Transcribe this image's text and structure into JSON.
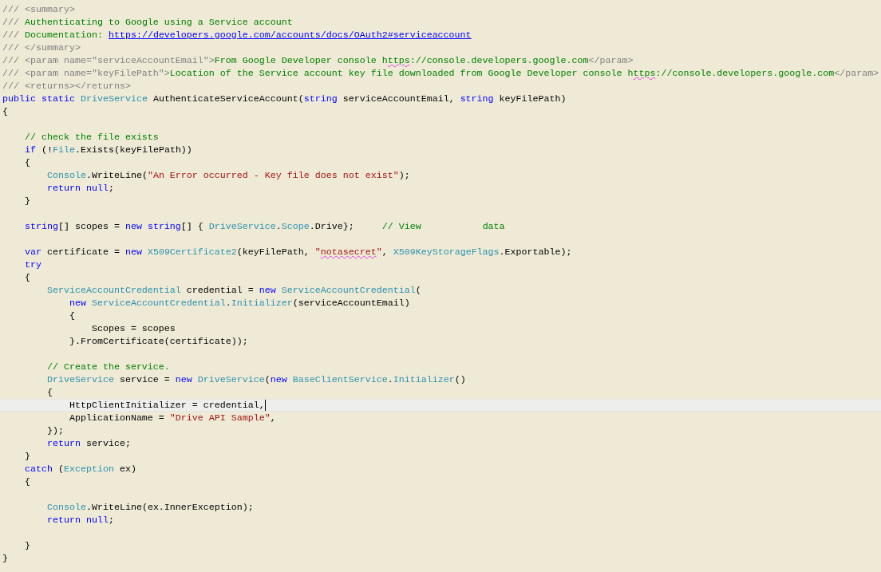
{
  "editor": {
    "lines": [
      {
        "current": false,
        "tokens": [
          {
            "text": "/// <summary>",
            "kind": "doc"
          }
        ]
      },
      {
        "current": false,
        "tokens": [
          {
            "text": "/// ",
            "kind": "doc"
          },
          {
            "text": "Authenticating to Google using a Service account",
            "kind": "comment"
          }
        ]
      },
      {
        "current": false,
        "tokens": [
          {
            "text": "/// ",
            "kind": "doc"
          },
          {
            "text": "Documentation: ",
            "kind": "comment"
          },
          {
            "text": "https://developers.google.com/accounts/docs/OAuth2#serviceaccount",
            "kind": "link"
          }
        ]
      },
      {
        "current": false,
        "tokens": [
          {
            "text": "/// </summary>",
            "kind": "doc"
          }
        ]
      },
      {
        "current": false,
        "tokens": [
          {
            "text": "/// <param name=\"serviceAccountEmail\">",
            "kind": "doc"
          },
          {
            "text": "From Google Developer console h",
            "kind": "comment"
          },
          {
            "text": "ttps",
            "kind": "typo"
          },
          {
            "text": "://console.developers.google.com",
            "kind": "comment"
          },
          {
            "text": "</param>",
            "kind": "doc"
          }
        ]
      },
      {
        "current": false,
        "tokens": [
          {
            "text": "/// <param name=\"keyFilePath\">",
            "kind": "doc"
          },
          {
            "text": "Location of the Service account key file downloaded from Google Developer console h",
            "kind": "comment"
          },
          {
            "text": "ttps",
            "kind": "typo"
          },
          {
            "text": "://console.developers.google.com",
            "kind": "comment"
          },
          {
            "text": "</param>",
            "kind": "doc"
          }
        ]
      },
      {
        "current": false,
        "tokens": [
          {
            "text": "/// <returns></returns>",
            "kind": "doc"
          }
        ]
      },
      {
        "current": false,
        "tokens": [
          {
            "text": "public static ",
            "kind": "keyword"
          },
          {
            "text": "DriveService",
            "kind": "type"
          },
          {
            "text": " AuthenticateServiceAccount(",
            "kind": "plain"
          },
          {
            "text": "string",
            "kind": "keyword"
          },
          {
            "text": " serviceAccountEmail, ",
            "kind": "plain"
          },
          {
            "text": "string",
            "kind": "keyword"
          },
          {
            "text": " keyFilePath)",
            "kind": "plain"
          }
        ]
      },
      {
        "current": false,
        "tokens": [
          {
            "text": "{",
            "kind": "plain"
          }
        ]
      },
      {
        "current": false
      },
      {
        "current": false,
        "tokens": [
          {
            "text": "    // check the file exists",
            "kind": "comment"
          }
        ]
      },
      {
        "current": false,
        "tokens": [
          {
            "text": "    if",
            "kind": "keyword"
          },
          {
            "text": " (!",
            "kind": "plain"
          },
          {
            "text": "File",
            "kind": "type"
          },
          {
            "text": ".Exists(keyFilePath))",
            "kind": "plain"
          }
        ]
      },
      {
        "current": false,
        "tokens": [
          {
            "text": "    {",
            "kind": "plain"
          }
        ]
      },
      {
        "current": false,
        "tokens": [
          {
            "text": "        Console",
            "kind": "type"
          },
          {
            "text": ".WriteLine(",
            "kind": "plain"
          },
          {
            "text": "\"An Error occurred - Key file does not exist\"",
            "kind": "string"
          },
          {
            "text": ");",
            "kind": "plain"
          }
        ]
      },
      {
        "current": false,
        "tokens": [
          {
            "text": "        return null",
            "kind": "keyword"
          },
          {
            "text": ";",
            "kind": "plain"
          }
        ]
      },
      {
        "current": false,
        "tokens": [
          {
            "text": "    }",
            "kind": "plain"
          }
        ]
      },
      {
        "current": false
      },
      {
        "current": false,
        "tokens": [
          {
            "text": "    string",
            "kind": "keyword"
          },
          {
            "text": "[] scopes = ",
            "kind": "plain"
          },
          {
            "text": "new string",
            "kind": "keyword"
          },
          {
            "text": "[] { ",
            "kind": "plain"
          },
          {
            "text": "DriveService",
            "kind": "type"
          },
          {
            "text": ".",
            "kind": "plain"
          },
          {
            "text": "Scope",
            "kind": "type"
          },
          {
            "text": ".Drive};     ",
            "kind": "plain"
          },
          {
            "text": "// View           data",
            "kind": "comment"
          }
        ]
      },
      {
        "current": false
      },
      {
        "current": false,
        "tokens": [
          {
            "text": "    var",
            "kind": "keyword"
          },
          {
            "text": " certificate = ",
            "kind": "plain"
          },
          {
            "text": "new ",
            "kind": "keyword"
          },
          {
            "text": "X509Certificate2",
            "kind": "type"
          },
          {
            "text": "(keyFilePath, ",
            "kind": "plain"
          },
          {
            "text": "\"",
            "kind": "string"
          },
          {
            "text": "notasecret",
            "kind": "stringtypo"
          },
          {
            "text": "\"",
            "kind": "string"
          },
          {
            "text": ", ",
            "kind": "plain"
          },
          {
            "text": "X509KeyStorageFlags",
            "kind": "type"
          },
          {
            "text": ".Exportable);",
            "kind": "plain"
          }
        ]
      },
      {
        "current": false,
        "tokens": [
          {
            "text": "    try",
            "kind": "keyword"
          }
        ]
      },
      {
        "current": false,
        "tokens": [
          {
            "text": "    {",
            "kind": "plain"
          }
        ]
      },
      {
        "current": false,
        "tokens": [
          {
            "text": "        ServiceAccountCredential",
            "kind": "type"
          },
          {
            "text": " credential = ",
            "kind": "plain"
          },
          {
            "text": "new ",
            "kind": "keyword"
          },
          {
            "text": "ServiceAccountCredential",
            "kind": "type"
          },
          {
            "text": "(",
            "kind": "plain"
          }
        ]
      },
      {
        "current": false,
        "tokens": [
          {
            "text": "            new ",
            "kind": "keyword"
          },
          {
            "text": "ServiceAccountCredential",
            "kind": "type"
          },
          {
            "text": ".",
            "kind": "plain"
          },
          {
            "text": "Initializer",
            "kind": "type"
          },
          {
            "text": "(serviceAccountEmail)",
            "kind": "plain"
          }
        ]
      },
      {
        "current": false,
        "tokens": [
          {
            "text": "            {",
            "kind": "plain"
          }
        ]
      },
      {
        "current": false,
        "tokens": [
          {
            "text": "                Scopes = scopes",
            "kind": "plain"
          }
        ]
      },
      {
        "current": false,
        "tokens": [
          {
            "text": "            }.FromCertificate(certificate));",
            "kind": "plain"
          }
        ]
      },
      {
        "current": false
      },
      {
        "current": false,
        "tokens": [
          {
            "text": "        // Create the service.",
            "kind": "comment"
          }
        ]
      },
      {
        "current": false,
        "tokens": [
          {
            "text": "        DriveService",
            "kind": "type"
          },
          {
            "text": " service = ",
            "kind": "plain"
          },
          {
            "text": "new ",
            "kind": "keyword"
          },
          {
            "text": "DriveService",
            "kind": "type"
          },
          {
            "text": "(",
            "kind": "plain"
          },
          {
            "text": "new ",
            "kind": "keyword"
          },
          {
            "text": "BaseClientService",
            "kind": "type"
          },
          {
            "text": ".",
            "kind": "plain"
          },
          {
            "text": "Initializer",
            "kind": "type"
          },
          {
            "text": "()",
            "kind": "plain"
          }
        ]
      },
      {
        "current": false,
        "tokens": [
          {
            "text": "        {",
            "kind": "plain"
          }
        ]
      },
      {
        "current": true,
        "tokens": [
          {
            "text": "            HttpClientInitializer = credential,",
            "kind": "plain"
          }
        ]
      },
      {
        "current": false,
        "tokens": [
          {
            "text": "            ApplicationName = ",
            "kind": "plain"
          },
          {
            "text": "\"Drive API Sample\"",
            "kind": "string"
          },
          {
            "text": ",",
            "kind": "plain"
          }
        ]
      },
      {
        "current": false,
        "tokens": [
          {
            "text": "        });",
            "kind": "plain"
          }
        ]
      },
      {
        "current": false,
        "tokens": [
          {
            "text": "        return",
            "kind": "keyword"
          },
          {
            "text": " service;",
            "kind": "plain"
          }
        ]
      },
      {
        "current": false,
        "tokens": [
          {
            "text": "    }",
            "kind": "plain"
          }
        ]
      },
      {
        "current": false,
        "tokens": [
          {
            "text": "    catch",
            "kind": "keyword"
          },
          {
            "text": " (",
            "kind": "plain"
          },
          {
            "text": "Exception",
            "kind": "type"
          },
          {
            "text": " ex)",
            "kind": "plain"
          }
        ]
      },
      {
        "current": false,
        "tokens": [
          {
            "text": "    {",
            "kind": "plain"
          }
        ]
      },
      {
        "current": false
      },
      {
        "current": false,
        "tokens": [
          {
            "text": "        Console",
            "kind": "type"
          },
          {
            "text": ".WriteLine(ex.InnerException);",
            "kind": "plain"
          }
        ]
      },
      {
        "current": false,
        "tokens": [
          {
            "text": "        return null",
            "kind": "keyword"
          },
          {
            "text": ";",
            "kind": "plain"
          }
        ]
      },
      {
        "current": false
      },
      {
        "current": false,
        "tokens": [
          {
            "text": "    }",
            "kind": "plain"
          }
        ]
      },
      {
        "current": false,
        "tokens": [
          {
            "text": "}",
            "kind": "plain"
          }
        ]
      }
    ]
  }
}
